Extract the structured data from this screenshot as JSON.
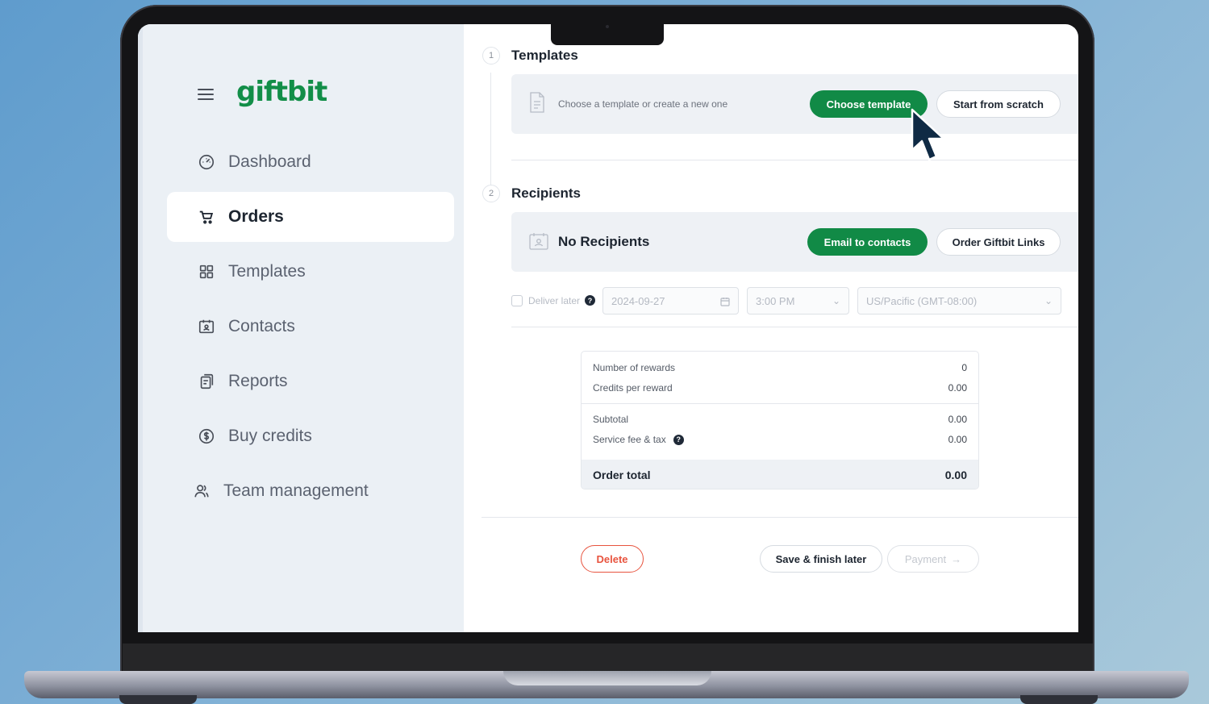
{
  "brand": {
    "logo": "giftbit",
    "accent": "#128e48"
  },
  "sidebar": {
    "items": [
      {
        "label": "Dashboard",
        "icon": "dashboard-gauge-icon",
        "active": false
      },
      {
        "label": "Orders",
        "icon": "cart-icon",
        "active": true
      },
      {
        "label": "Templates",
        "icon": "grid-icon",
        "active": false
      },
      {
        "label": "Contacts",
        "icon": "contact-card-icon",
        "active": false
      },
      {
        "label": "Reports",
        "icon": "reports-icon",
        "active": false
      },
      {
        "label": "Buy credits",
        "icon": "dollar-coin-icon",
        "active": false
      },
      {
        "label": "Team management",
        "icon": "team-icon",
        "active": false
      }
    ]
  },
  "templates": {
    "step": "1",
    "title": "Templates",
    "hint": "Choose a template or create a new one",
    "choose_label": "Choose template",
    "scratch_label": "Start from scratch"
  },
  "recipients": {
    "step": "2",
    "title": "Recipients",
    "empty_label": "No Recipients",
    "email_label": "Email to contacts",
    "links_label": "Order Giftbit Links"
  },
  "delivery": {
    "deliver_later_label": "Deliver later",
    "help": "?",
    "date_value": "2024-09-27",
    "time_value": "3:00 PM",
    "timezone_value": "US/Pacific (GMT-08:00)"
  },
  "summary": {
    "rows": [
      {
        "label": "Number of rewards",
        "value": "0"
      },
      {
        "label": "Credits per reward",
        "value": "0.00"
      },
      {
        "label": "Subtotal",
        "value": "0.00"
      },
      {
        "label": "Service fee & tax",
        "value": "0.00"
      }
    ],
    "total_label": "Order total",
    "total_value": "0.00"
  },
  "footer": {
    "delete_label": "Delete",
    "save_label": "Save & finish later",
    "payment_label": "Payment",
    "payment_arrow": "→"
  }
}
